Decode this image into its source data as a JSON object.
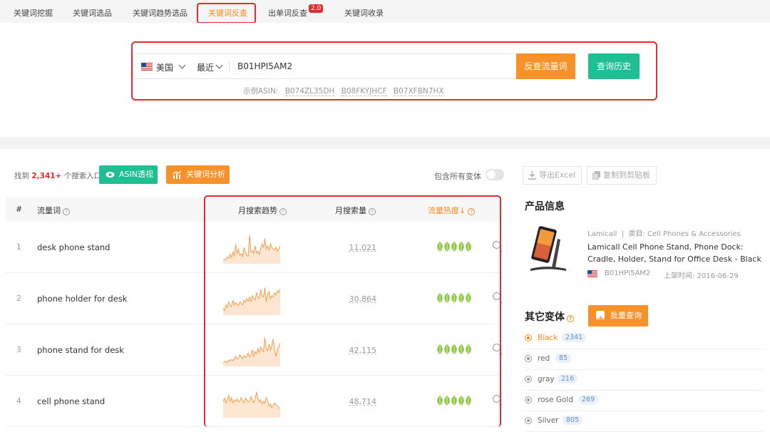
{
  "tabs": [
    "关键词挖掘",
    "关键词选品",
    "关键词趋势选品",
    "关键词反查",
    "出单词反查",
    "关键词收录"
  ],
  "tab_badge": "2.0",
  "search": {
    "country": "美国",
    "time": "最近",
    "asin": "B01HPI5AM2",
    "reverse_button": "反查流量词",
    "history_button": "查询历史",
    "examples_label": "示例ASIN:",
    "examples": [
      "B074ZL35DH",
      "B08FKYJHCF",
      "B07XFBN7HX"
    ]
  },
  "toolbar": {
    "found_prefix": "找到",
    "found_count": "2,341+",
    "found_suffix": "个搜索入口",
    "asin_button": "ASIN透视",
    "kw_button": "关键词分析",
    "variants_label": "包含所有变体",
    "export_button": "导出Excel",
    "copy_button": "复制到剪贴板"
  },
  "table": {
    "headers": {
      "index": "#",
      "keyword": "流量词",
      "trend": "月搜索趋势",
      "volume": "月搜索量",
      "heat": "流量热度↓"
    },
    "rows": [
      {
        "index": "1",
        "keyword": "desk phone stand",
        "volume": "11,021",
        "trend": [
          0.08,
          0.12,
          0.1,
          0.2,
          0.14,
          0.28,
          0.18,
          0.35,
          0.22,
          0.6,
          0.3,
          0.45,
          0.25,
          0.3,
          0.2,
          0.5,
          0.35,
          0.25,
          0.22,
          0.9,
          0.35,
          0.4,
          0.3,
          0.55,
          0.32,
          0.38,
          0.28,
          0.48,
          0.6,
          0.5,
          0.78,
          0.45,
          0.55,
          0.4,
          0.62,
          0.5,
          0.45,
          0.42,
          0.5,
          0.38,
          0.46,
          0.55
        ]
      },
      {
        "index": "2",
        "keyword": "phone holder for desk",
        "volume": "30,864",
        "trend": [
          0.2,
          0.12,
          0.3,
          0.22,
          0.4,
          0.28,
          0.25,
          0.45,
          0.3,
          0.38,
          0.32,
          0.28,
          0.4,
          0.35,
          0.3,
          0.45,
          0.38,
          0.5,
          0.42,
          0.55,
          0.4,
          0.6,
          0.5,
          0.45,
          0.7,
          0.55,
          0.5,
          0.8,
          0.6,
          0.55,
          0.85,
          0.4,
          0.65,
          0.72,
          0.5,
          0.6,
          0.55,
          0.68,
          0.62,
          0.75,
          0.7,
          0.82
        ]
      },
      {
        "index": "3",
        "keyword": "phone stand for desk",
        "volume": "42,115",
        "trend": [
          0.1,
          0.12,
          0.15,
          0.1,
          0.18,
          0.14,
          0.2,
          0.16,
          0.22,
          0.3,
          0.2,
          0.25,
          0.35,
          0.28,
          0.22,
          0.32,
          0.26,
          0.3,
          0.4,
          0.28,
          0.35,
          0.5,
          0.3,
          0.45,
          0.38,
          0.55,
          0.42,
          0.6,
          0.5,
          0.45,
          0.9,
          0.55,
          0.48,
          0.7,
          0.5,
          0.65,
          0.85,
          0.5,
          0.3,
          0.55,
          0.6,
          0.72
        ]
      },
      {
        "index": "4",
        "keyword": "cell phone stand",
        "volume": "48,714",
        "trend": [
          0.5,
          0.6,
          0.45,
          0.55,
          0.7,
          0.5,
          0.62,
          0.45,
          0.55,
          0.5,
          0.58,
          0.48,
          0.52,
          0.62,
          0.5,
          0.45,
          0.6,
          0.55,
          0.48,
          0.5,
          0.65,
          0.55,
          0.45,
          0.58,
          0.8,
          0.6,
          0.48,
          0.55,
          0.42,
          0.5,
          0.45,
          0.62,
          0.5,
          0.35,
          0.42,
          0.3,
          0.38,
          0.45,
          0.4,
          0.35,
          0.3,
          0.28
        ]
      }
    ]
  },
  "product": {
    "panel_title": "产品信息",
    "brand": "Lamicall",
    "category": "类目: Cell Phones & Accessories",
    "title": "Lamicall Cell Phone Stand, Phone Dock: Cradle, Holder, Stand for Office Desk - Black",
    "asin": "B01HPI5AM2",
    "date": "上架时间: 2016-06-29"
  },
  "variants": {
    "title": "其它变体",
    "batch_button": "批量查询",
    "items": [
      {
        "name": "Black",
        "count": "2341"
      },
      {
        "name": "red",
        "count": "85"
      },
      {
        "name": "gray",
        "count": "216"
      },
      {
        "name": "rose Gold",
        "count": "269"
      },
      {
        "name": "Silver",
        "count": "805"
      }
    ]
  },
  "colors": {
    "accent": "#f7922b",
    "green": "#1fbf93",
    "red": "#e52b2b",
    "trend_line": "#f0a050",
    "leaf": "#8cc63f"
  }
}
